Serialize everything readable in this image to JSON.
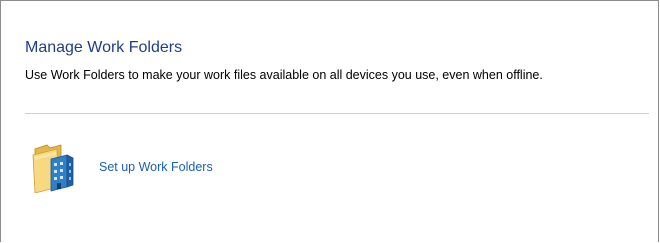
{
  "page": {
    "title": "Manage Work Folders",
    "description": "Use Work Folders to make your work files available on all devices you use, even when offline."
  },
  "actions": {
    "setup_label": "Set up Work Folders",
    "setup_icon": "work-folders-icon"
  },
  "colors": {
    "title": "#1e3f87",
    "link": "#1c5fb8",
    "divider": "#cfcfcf"
  }
}
